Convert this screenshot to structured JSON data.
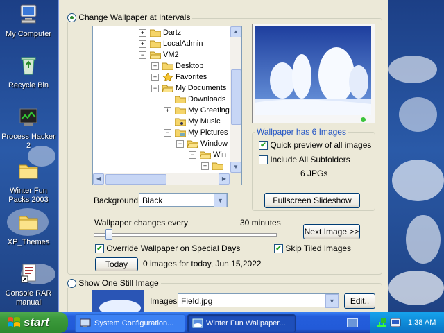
{
  "desktop": {
    "icons": [
      {
        "label": "My Computer",
        "icon": "computer-icon"
      },
      {
        "label": "Recycle Bin",
        "icon": "recycle-bin-icon"
      },
      {
        "label": "Process Hacker 2",
        "icon": "process-hacker-icon"
      },
      {
        "label": "Winter Fun Packs 2003",
        "icon": "folder-icon"
      },
      {
        "label": "XP_Themes",
        "icon": "folder-icon"
      },
      {
        "label": "Console RAR manual",
        "icon": "document-shortcut-icon"
      }
    ]
  },
  "dialog": {
    "interval_radio_label": "Change Wallpaper at Intervals",
    "tree": {
      "items": [
        {
          "label": "Dartz",
          "expander": "+",
          "icon": "folder-icon"
        },
        {
          "label": "LocalAdmin",
          "expander": "+",
          "icon": "folder-icon"
        },
        {
          "label": "VM2",
          "expander": "−",
          "icon": "folder-open-icon"
        },
        {
          "label": "Desktop",
          "expander": "+",
          "icon": "folder-icon"
        },
        {
          "label": "Favorites",
          "expander": "+",
          "icon": "star-icon"
        },
        {
          "label": "My Documents",
          "expander": "−",
          "icon": "folder-open-icon"
        },
        {
          "label": "Downloads",
          "expander": "",
          "icon": "folder-icon"
        },
        {
          "label": "My Greeting",
          "expander": "+",
          "icon": "folder-icon"
        },
        {
          "label": "My Music",
          "expander": "",
          "icon": "music-folder-icon"
        },
        {
          "label": "My Pictures",
          "expander": "−",
          "icon": "pictures-folder-icon"
        },
        {
          "label": "Window",
          "expander": "−",
          "icon": "folder-open-icon"
        },
        {
          "label": "Win",
          "expander": "−",
          "icon": "folder-open-icon"
        },
        {
          "label": "",
          "expander": "+",
          "icon": "folder-icon"
        }
      ]
    },
    "wallpaper_info_title": "Wallpaper has 6 Images",
    "quick_preview_label": "Quick preview of all images",
    "include_subfolders_label": "Include All Subfolders",
    "jpg_count": "6 JPGs",
    "fullscreen_button": "Fullscreen Slideshow",
    "background_label": "Background",
    "background_value": "Black",
    "changes_every_label": "Wallpaper changes every",
    "interval_value": "30 minutes",
    "interval_slider_fraction": 0.08,
    "next_image_button": "Next Image >>",
    "override_label": "Override Wallpaper on Special Days",
    "skip_tiled_label": "Skip Tiled Images",
    "today_button": "Today",
    "today_status": "0 images for today, Jun 15,2022",
    "still_radio_label": "Show One Still Image",
    "images_label": "Images:",
    "images_value": "Field.jpg",
    "edit_button": "Edit.."
  },
  "taskbar": {
    "start_label": "start",
    "tasks": [
      {
        "label": "System Configuration...",
        "icon": "system-config-icon",
        "active": false
      },
      {
        "label": "Winter Fun Wallpaper...",
        "icon": "wallpaper-app-icon",
        "active": true
      }
    ],
    "clock": "1:38 AM"
  },
  "colors": {
    "taskbar_blue": "#245edc",
    "start_green": "#3c9a3c",
    "dialog_bg": "#ece9d8",
    "check_green": "#21a121"
  }
}
